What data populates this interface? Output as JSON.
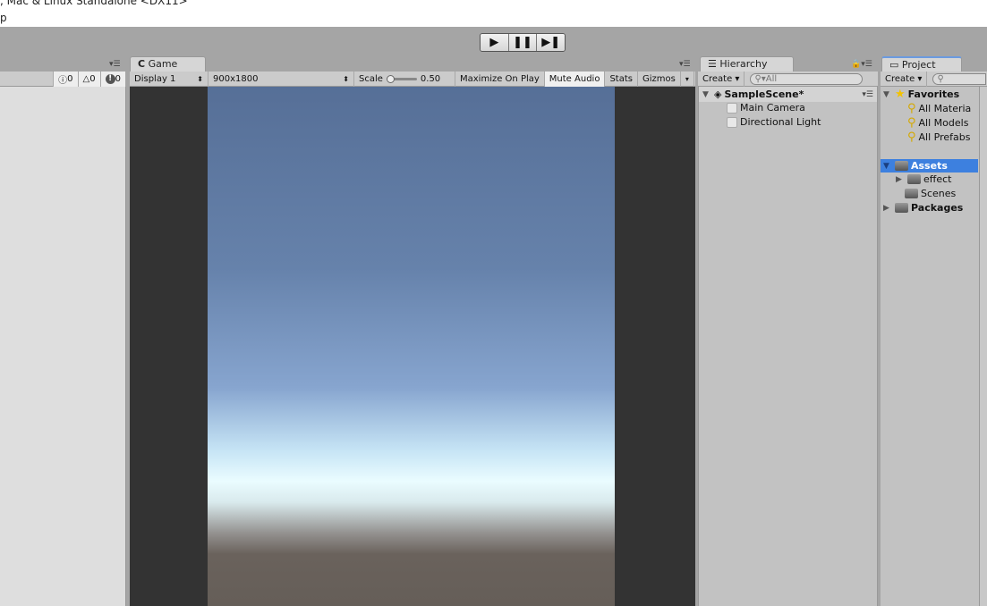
{
  "window": {
    "title": ", Mac & Linux Standalone <DX11>",
    "menu_fragment": "p"
  },
  "playbar": {
    "play": "▶",
    "pause": "❚❚",
    "step": "▶❚"
  },
  "console": {
    "info_count": "0",
    "warn_count": "0",
    "error_count": "0"
  },
  "game": {
    "tab": "Game",
    "display": "Display 1",
    "resolution": "900x1800",
    "scale_label": "Scale",
    "scale_value": "0.50",
    "scale_fraction": 0.5,
    "maximize": "Maximize On Play",
    "mute": "Mute Audio",
    "stats": "Stats",
    "gizmos": "Gizmos",
    "mute_active": true
  },
  "hierarchy": {
    "tab": "Hierarchy",
    "create": "Create",
    "search_placeholder": "All",
    "scene": "SampleScene*",
    "items": [
      "Main Camera",
      "Directional Light"
    ]
  },
  "project": {
    "tab": "Project",
    "create": "Create",
    "favorites": "Favorites",
    "fav_items": [
      "All Materia",
      "All Models",
      "All Prefabs"
    ],
    "assets": "Assets",
    "asset_children": [
      "effect",
      "Scenes"
    ],
    "packages": "Packages"
  },
  "colors": {
    "selection": "#3d80df",
    "sky_top": "#566f97",
    "ground": "#6a625c"
  }
}
